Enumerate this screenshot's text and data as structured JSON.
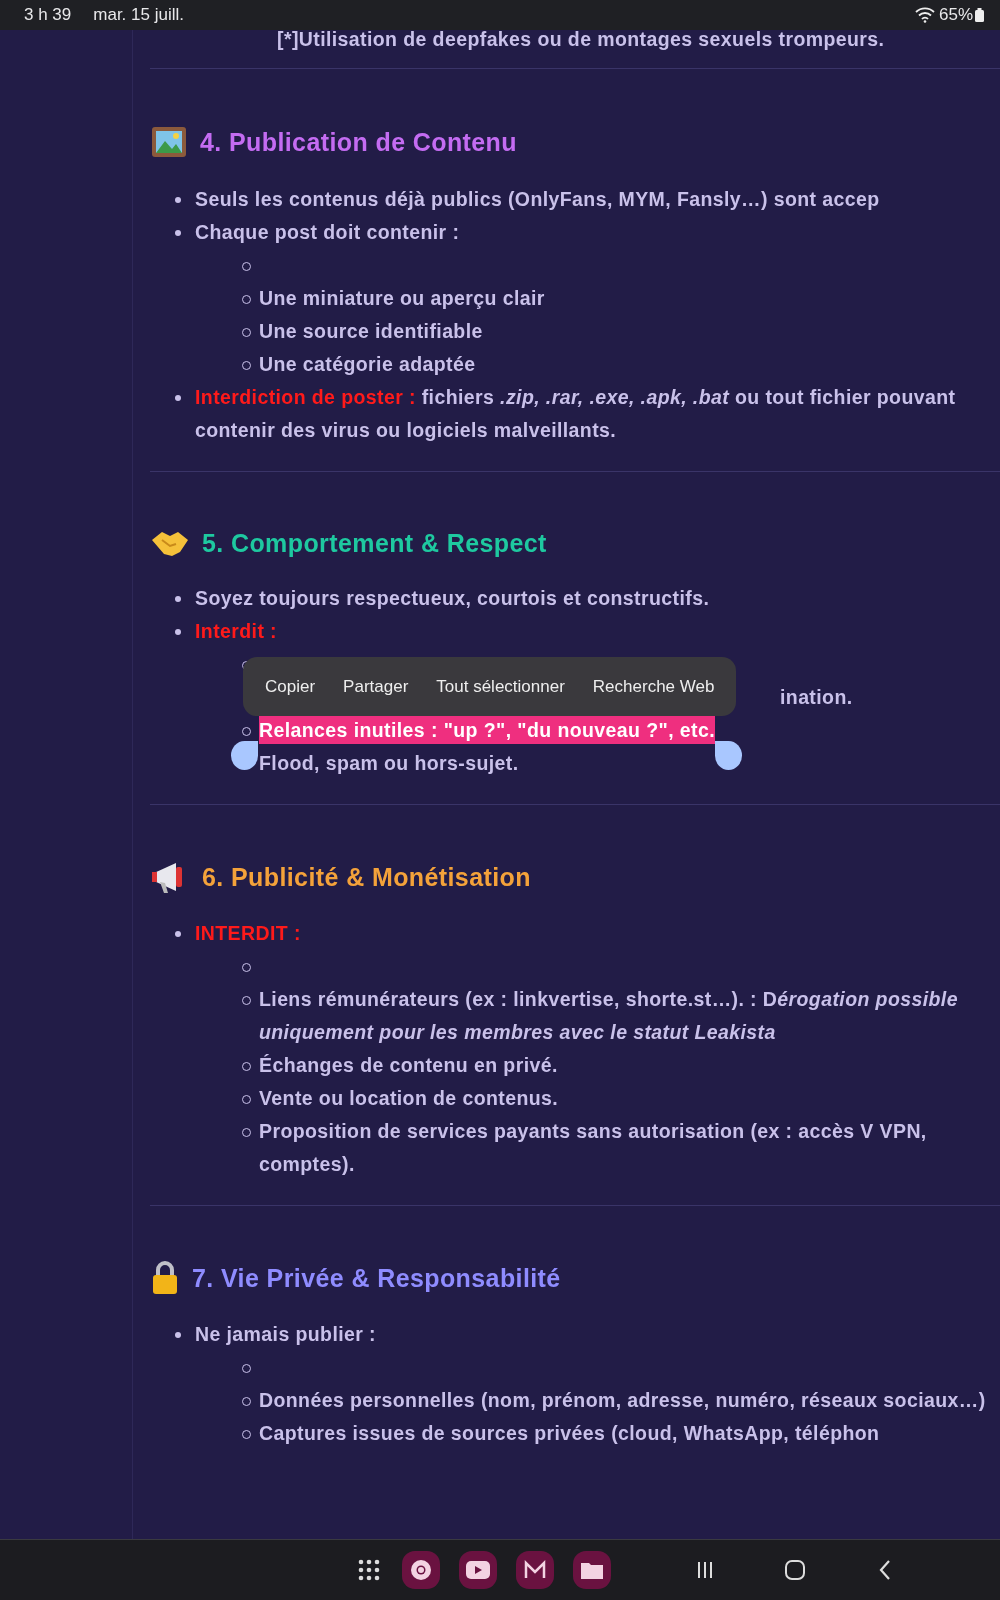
{
  "status_bar": {
    "time": "3 h 39",
    "date": "mar. 15 juill.",
    "battery": "65%"
  },
  "top_item": "[*]Utilisation de deepfakes ou de montages sexuels trompeurs.",
  "sections": [
    {
      "title": "4. Publication de Contenu",
      "color": "#c46cf2",
      "items": [
        {
          "text": "Seuls les contenus déjà publics (OnlyFans, MYM, Fansly…) sont accep"
        },
        {
          "text": "Chaque post doit contenir :",
          "children": [
            {
              "kind": "empty"
            },
            {
              "kind": "text",
              "text": "Une miniature ou aperçu clair"
            },
            {
              "kind": "text",
              "text": "Une source identifiable"
            },
            {
              "kind": "text",
              "text": "Une catégorie adaptée"
            }
          ]
        },
        {
          "label": "Interdiction de poster :",
          "text": "fichiers *.zip, .rar, .exe, .apk, .bat* ou tout fichier pouvant contenir des virus ou logiciels malveillants."
        }
      ]
    },
    {
      "title": "5. Comportement & Respect",
      "color": "#1ec9a0",
      "items": [
        {
          "text": "Soyez toujours respectueux, courtois et constructifs."
        },
        {
          "label": "Interdit :",
          "children": [
            {
              "kind": "empty"
            },
            {
              "kind": "covered",
              "text": "ination."
            },
            {
              "kind": "text",
              "text": "Relances inutiles : \"up ?\", \"du nouveau ?\", etc.",
              "selected": true
            },
            {
              "kind": "text",
              "text": "Flood, spam ou hors-sujet.",
              "selected": false,
              "bullet": false
            }
          ]
        }
      ],
      "selection_menu": [
        "Copier",
        "Partager",
        "Tout sélectionner",
        "Recherche Web"
      ]
    },
    {
      "title": "6. Publicité & Monétisation",
      "color": "#f4a23a",
      "items": [
        {
          "label": "INTERDIT :",
          "children": [
            {
              "kind": "empty"
            },
            {
              "kind": "text",
              "text": "Liens rémunérateurs (ex : linkvertise, shorte.st…). : D",
              "italic_text": "érogation possible uniquement pour les membres avec le statut Leakista"
            },
            {
              "kind": "text",
              "text": "Échanges de contenu en privé."
            },
            {
              "kind": "text",
              "text": "Vente ou location de contenus."
            },
            {
              "kind": "text",
              "text": "Proposition de services payants sans autorisation (ex : accès V VPN, comptes)."
            }
          ]
        }
      ]
    },
    {
      "title": "7. Vie Privée & Responsabilité",
      "color": "#8f8cff",
      "items": [
        {
          "text": "Ne jamais publier :",
          "children": [
            {
              "kind": "empty"
            },
            {
              "kind": "text",
              "text": "Données personnelles (nom, prénom, adresse, numéro, réseaux sociaux…)"
            },
            {
              "kind": "text",
              "text": "Captures issues de sources privées (cloud, WhatsApp, téléphon"
            }
          ]
        }
      ]
    }
  ]
}
